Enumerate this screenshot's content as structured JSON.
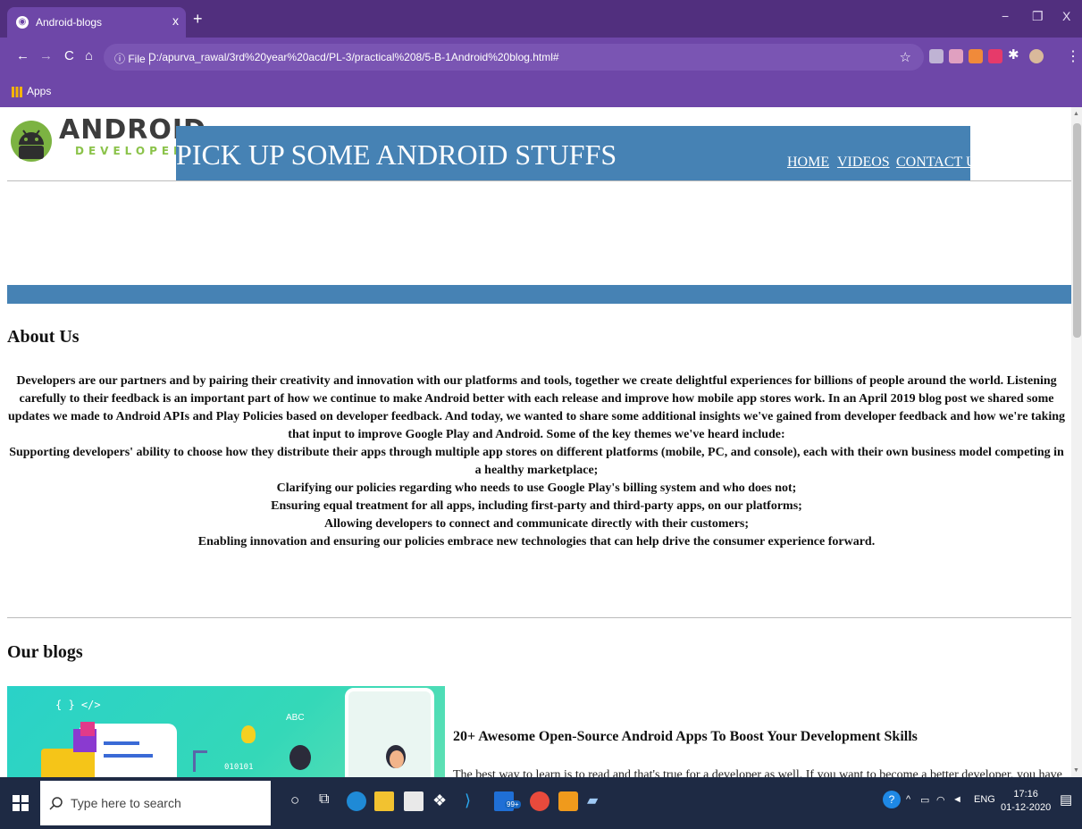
{
  "browser": {
    "tab_title": "Android-blogs",
    "tab_close": "x",
    "new_tab": "+",
    "window_minimize": "−",
    "window_restore": "❐",
    "window_close": "X",
    "nav_back": "←",
    "nav_forward": "→",
    "nav_reload": "C",
    "nav_home": "⌂",
    "url_info": "ⓘ File |",
    "url": "D:/apurva_rawal/3rd%20year%20acd/PL-3/practical%208/5-B-1Android%20blog.html#",
    "bookmarks_apps_label": "Apps"
  },
  "site": {
    "logo_word": "ANDROID",
    "logo_sub": "DEVELOPER",
    "title": "PICK UP SOME ANDROID STUFFS",
    "nav": [
      "HOME",
      "VIDEOS",
      "CONTACT US"
    ]
  },
  "about": {
    "heading": "About Us",
    "paragraph": "Developers are our partners and by pairing their creativity and innovation with our platforms and tools, together we create delightful experiences for billions of people around the world. Listening carefully to their feedback is an important part of how we continue to make Android better with each release and improve how mobile app stores work. In an April 2019 blog post we shared some updates we made to Android APIs and Play Policies based on developer feedback. And today, we wanted to share some additional insights we've gained from developer feedback and how we're taking that input to improve Google Play and Android. Some of the key themes we've heard include:",
    "items": [
      "Supporting developers' ability to choose how they distribute their apps through multiple app stores on different platforms (mobile, PC, and console), each with their own business model competing in a healthy marketplace;",
      "Clarifying our policies regarding who needs to use Google Play's billing system and who does not;",
      "Ensuring equal treatment for all apps, including first-party and third-party apps, on our platforms;",
      "Allowing developers to connect and communicate directly with their customers;",
      "Enabling innovation and ensuring our policies embrace new technologies that can help drive the consumer experience forward."
    ]
  },
  "blogs": {
    "heading": "Our blogs",
    "image_labels": {
      "code": "{ } </>",
      "abc": "ABC",
      "binary": "010101"
    },
    "post_title": "20+ Awesome Open-Source Android Apps To Boost Your Development Skills",
    "post_excerpt": "The best way to learn is to read and that's true for a developer as well. If you want to become a better developer, you have to read more code. It's as simple as that. Books, blogs, forums are all good to a certain extent but there is nothing that can replace some"
  },
  "taskbar": {
    "search_placeholder": "Type here to search",
    "mail_badge": "99+",
    "tray_lang": "ENG",
    "time": "17:16",
    "date": "01-12-2020"
  },
  "colors": {
    "chrome_dark": "#512f7e",
    "chrome": "#6e47a8",
    "header_blue": "#4682b4",
    "android_green": "#8bc34a"
  }
}
